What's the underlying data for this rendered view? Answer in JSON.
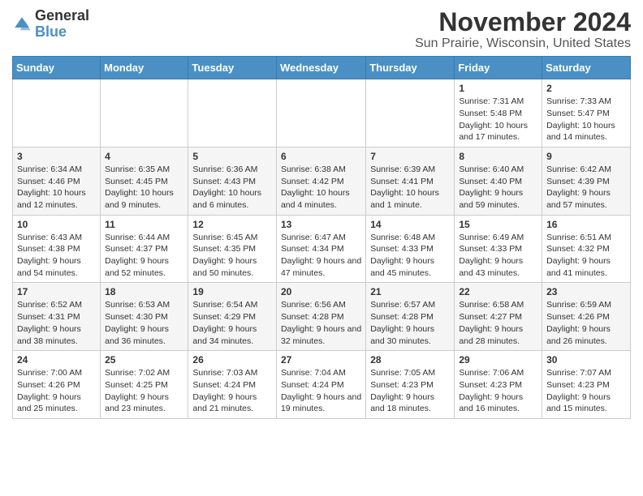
{
  "header": {
    "logo_general": "General",
    "logo_blue": "Blue",
    "title": "November 2024",
    "subtitle": "Sun Prairie, Wisconsin, United States"
  },
  "columns": [
    "Sunday",
    "Monday",
    "Tuesday",
    "Wednesday",
    "Thursday",
    "Friday",
    "Saturday"
  ],
  "weeks": [
    [
      {
        "day": "",
        "info": ""
      },
      {
        "day": "",
        "info": ""
      },
      {
        "day": "",
        "info": ""
      },
      {
        "day": "",
        "info": ""
      },
      {
        "day": "",
        "info": ""
      },
      {
        "day": "1",
        "info": "Sunrise: 7:31 AM\nSunset: 5:48 PM\nDaylight: 10 hours and 17 minutes."
      },
      {
        "day": "2",
        "info": "Sunrise: 7:33 AM\nSunset: 5:47 PM\nDaylight: 10 hours and 14 minutes."
      }
    ],
    [
      {
        "day": "3",
        "info": "Sunrise: 6:34 AM\nSunset: 4:46 PM\nDaylight: 10 hours and 12 minutes."
      },
      {
        "day": "4",
        "info": "Sunrise: 6:35 AM\nSunset: 4:45 PM\nDaylight: 10 hours and 9 minutes."
      },
      {
        "day": "5",
        "info": "Sunrise: 6:36 AM\nSunset: 4:43 PM\nDaylight: 10 hours and 6 minutes."
      },
      {
        "day": "6",
        "info": "Sunrise: 6:38 AM\nSunset: 4:42 PM\nDaylight: 10 hours and 4 minutes."
      },
      {
        "day": "7",
        "info": "Sunrise: 6:39 AM\nSunset: 4:41 PM\nDaylight: 10 hours and 1 minute."
      },
      {
        "day": "8",
        "info": "Sunrise: 6:40 AM\nSunset: 4:40 PM\nDaylight: 9 hours and 59 minutes."
      },
      {
        "day": "9",
        "info": "Sunrise: 6:42 AM\nSunset: 4:39 PM\nDaylight: 9 hours and 57 minutes."
      }
    ],
    [
      {
        "day": "10",
        "info": "Sunrise: 6:43 AM\nSunset: 4:38 PM\nDaylight: 9 hours and 54 minutes."
      },
      {
        "day": "11",
        "info": "Sunrise: 6:44 AM\nSunset: 4:37 PM\nDaylight: 9 hours and 52 minutes."
      },
      {
        "day": "12",
        "info": "Sunrise: 6:45 AM\nSunset: 4:35 PM\nDaylight: 9 hours and 50 minutes."
      },
      {
        "day": "13",
        "info": "Sunrise: 6:47 AM\nSunset: 4:34 PM\nDaylight: 9 hours and 47 minutes."
      },
      {
        "day": "14",
        "info": "Sunrise: 6:48 AM\nSunset: 4:33 PM\nDaylight: 9 hours and 45 minutes."
      },
      {
        "day": "15",
        "info": "Sunrise: 6:49 AM\nSunset: 4:33 PM\nDaylight: 9 hours and 43 minutes."
      },
      {
        "day": "16",
        "info": "Sunrise: 6:51 AM\nSunset: 4:32 PM\nDaylight: 9 hours and 41 minutes."
      }
    ],
    [
      {
        "day": "17",
        "info": "Sunrise: 6:52 AM\nSunset: 4:31 PM\nDaylight: 9 hours and 38 minutes."
      },
      {
        "day": "18",
        "info": "Sunrise: 6:53 AM\nSunset: 4:30 PM\nDaylight: 9 hours and 36 minutes."
      },
      {
        "day": "19",
        "info": "Sunrise: 6:54 AM\nSunset: 4:29 PM\nDaylight: 9 hours and 34 minutes."
      },
      {
        "day": "20",
        "info": "Sunrise: 6:56 AM\nSunset: 4:28 PM\nDaylight: 9 hours and 32 minutes."
      },
      {
        "day": "21",
        "info": "Sunrise: 6:57 AM\nSunset: 4:28 PM\nDaylight: 9 hours and 30 minutes."
      },
      {
        "day": "22",
        "info": "Sunrise: 6:58 AM\nSunset: 4:27 PM\nDaylight: 9 hours and 28 minutes."
      },
      {
        "day": "23",
        "info": "Sunrise: 6:59 AM\nSunset: 4:26 PM\nDaylight: 9 hours and 26 minutes."
      }
    ],
    [
      {
        "day": "24",
        "info": "Sunrise: 7:00 AM\nSunset: 4:26 PM\nDaylight: 9 hours and 25 minutes."
      },
      {
        "day": "25",
        "info": "Sunrise: 7:02 AM\nSunset: 4:25 PM\nDaylight: 9 hours and 23 minutes."
      },
      {
        "day": "26",
        "info": "Sunrise: 7:03 AM\nSunset: 4:24 PM\nDaylight: 9 hours and 21 minutes."
      },
      {
        "day": "27",
        "info": "Sunrise: 7:04 AM\nSunset: 4:24 PM\nDaylight: 9 hours and 19 minutes."
      },
      {
        "day": "28",
        "info": "Sunrise: 7:05 AM\nSunset: 4:23 PM\nDaylight: 9 hours and 18 minutes."
      },
      {
        "day": "29",
        "info": "Sunrise: 7:06 AM\nSunset: 4:23 PM\nDaylight: 9 hours and 16 minutes."
      },
      {
        "day": "30",
        "info": "Sunrise: 7:07 AM\nSunset: 4:23 PM\nDaylight: 9 hours and 15 minutes."
      }
    ]
  ]
}
